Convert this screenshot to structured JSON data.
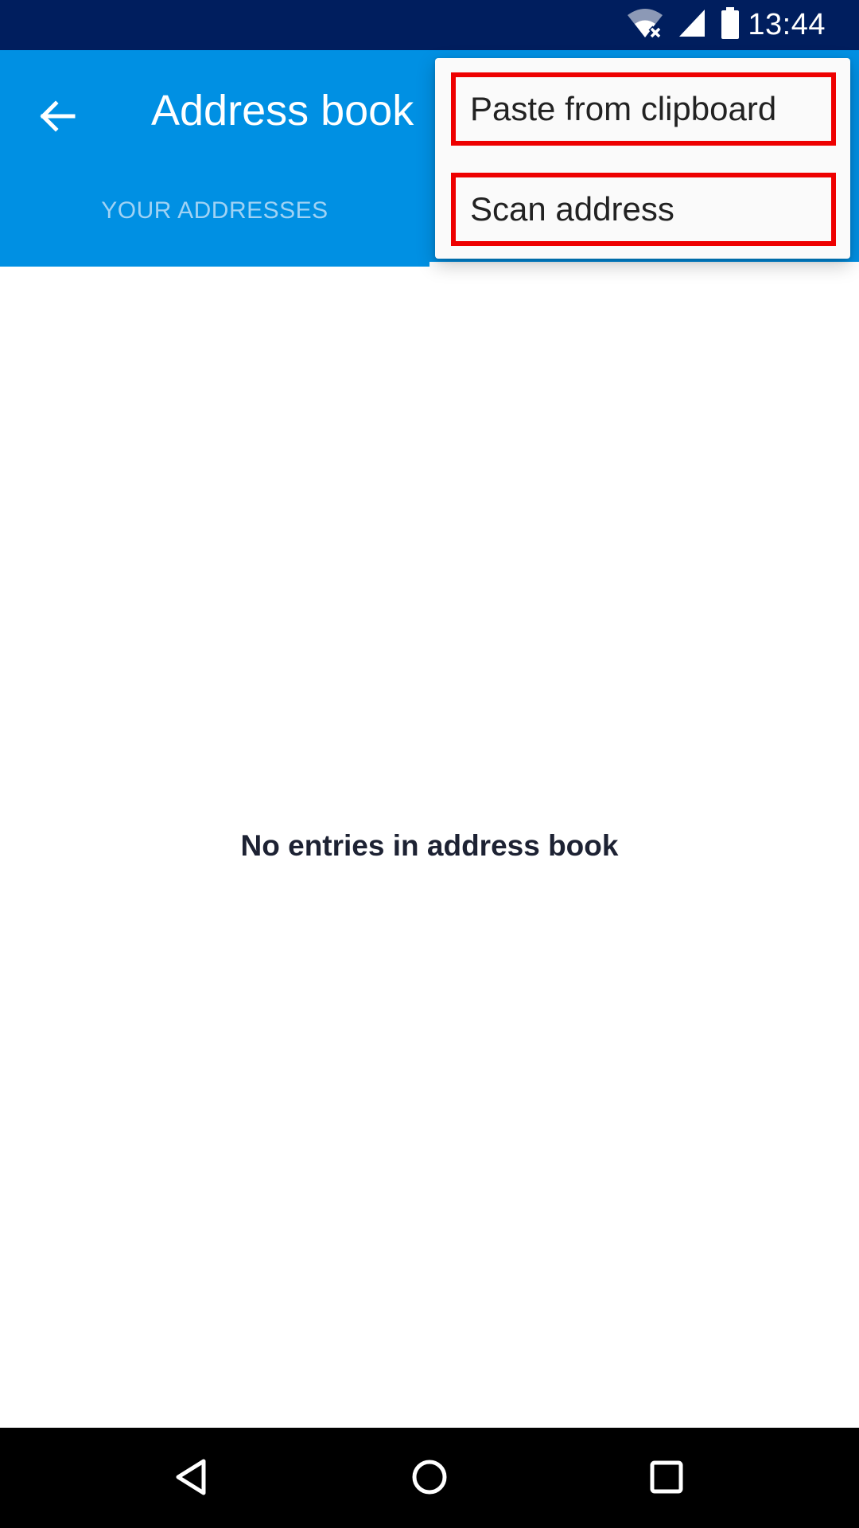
{
  "status_bar": {
    "time": "13:44",
    "icons": [
      "wifi-off-icon",
      "cell-signal-icon",
      "battery-icon"
    ]
  },
  "app_bar": {
    "title": "Address book",
    "back_icon": "arrow-left-icon",
    "tabs": [
      {
        "label": "YOUR ADDRESSES",
        "selected": false
      },
      {
        "label": "",
        "selected": true
      }
    ]
  },
  "menu": {
    "items": [
      {
        "label": "Paste from clipboard"
      },
      {
        "label": "Scan address"
      }
    ],
    "highlight_color": "#ee0000"
  },
  "main": {
    "empty_message": "No entries in address book"
  },
  "nav_bar": {
    "icons": [
      "nav-back-icon",
      "nav-home-icon",
      "nav-recents-icon"
    ]
  },
  "colors": {
    "status_bar": "#001e5e",
    "primary": "#0090e3",
    "background": "#ffffff"
  }
}
